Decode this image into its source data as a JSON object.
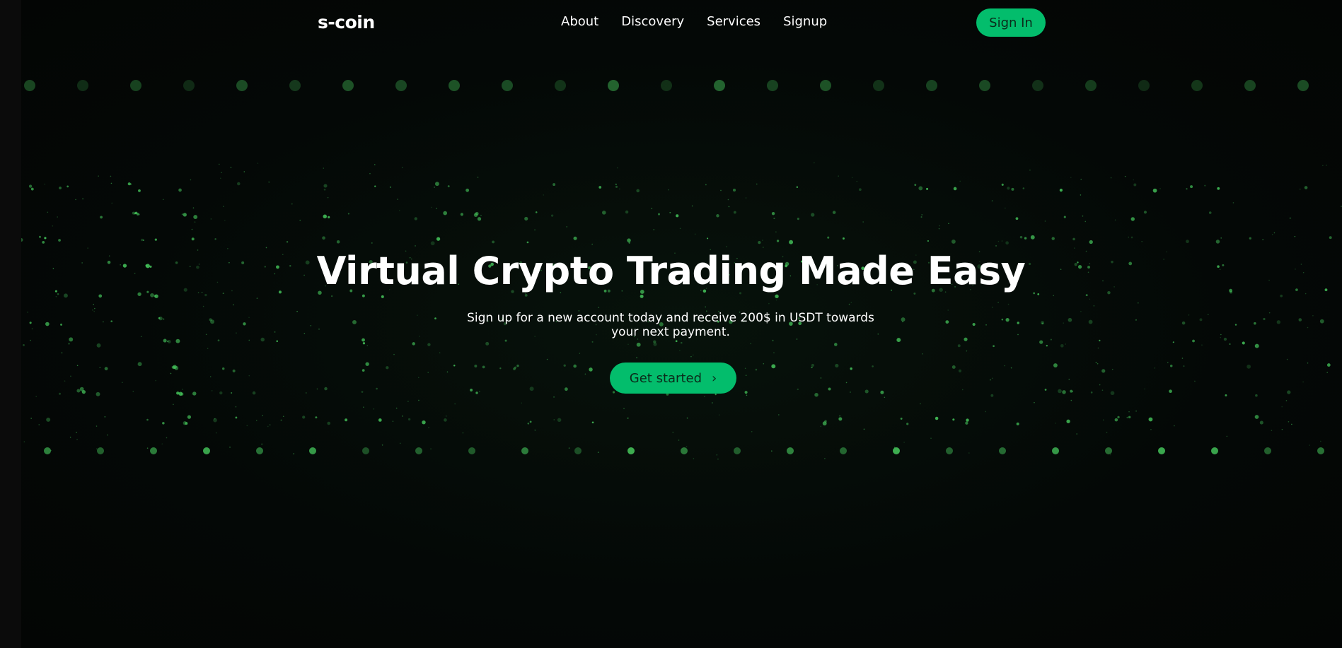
{
  "brand": {
    "logo": "s-coin"
  },
  "nav": {
    "links": [
      "About",
      "Discovery",
      "Services",
      "Signup"
    ],
    "signin_label": "Sign In"
  },
  "hero": {
    "title": "Virtual Crypto Trading Made Easy",
    "subtitle": "Sign up for a new account today and receive 200$ in USDT towards your next payment.",
    "cta_label": "Get started",
    "cta_icon": "chevron-right-icon"
  },
  "colors": {
    "accent": "#03bd6c",
    "background": "#050706",
    "glow": "#4cd964"
  }
}
